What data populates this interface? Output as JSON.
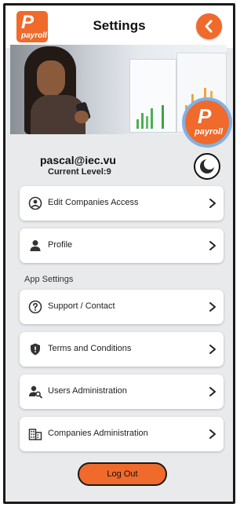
{
  "header": {
    "title": "Settings",
    "logo_glyph": "P",
    "logo_text": "payroll",
    "back_icon": "chevron-left-icon"
  },
  "banner": {
    "badge_glyph": "P",
    "badge_text": "payroll"
  },
  "user": {
    "email": "pascal@iec.vu",
    "level": "Current Level:9",
    "theme_icon": "moon-icon"
  },
  "menu": [
    {
      "label": "Edit Companies Access",
      "icon": "user-circle-icon"
    },
    {
      "label": "Profile",
      "icon": "person-icon"
    }
  ],
  "app_settings": {
    "section_label": "App Settings",
    "items": [
      {
        "label": "Support / Contact",
        "icon": "help-circle-icon"
      },
      {
        "label": "Terms and Conditions",
        "icon": "shield-icon"
      },
      {
        "label": "Users Administration",
        "icon": "user-search-icon"
      },
      {
        "label": "Companies Administration",
        "icon": "building-icon"
      }
    ]
  },
  "logout_label": "Log Out",
  "colors": {
    "accent": "#ef6a2b",
    "background": "#e9eaec",
    "card": "#ffffff"
  }
}
